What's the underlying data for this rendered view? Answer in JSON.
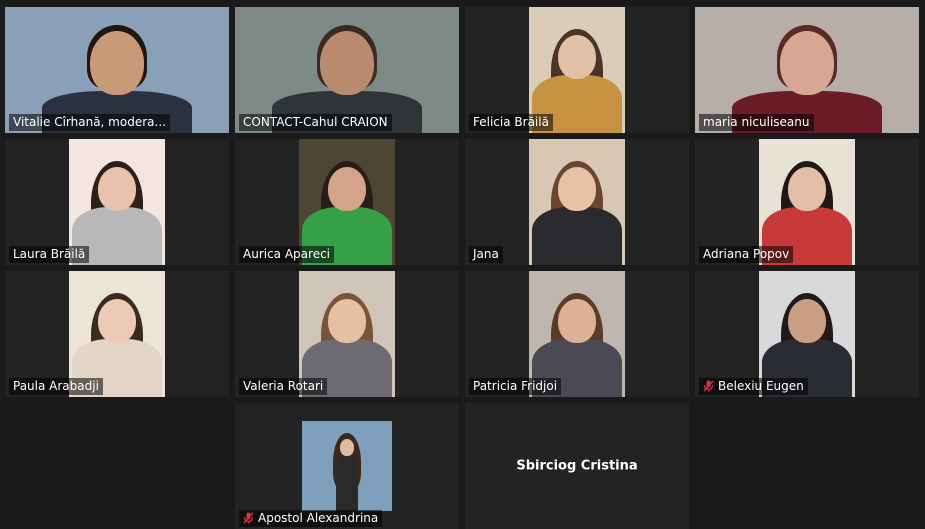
{
  "participants": [
    {
      "name": "Vitalie Cîrhană, modera...",
      "muted": false,
      "active": false,
      "video": true,
      "style": "office",
      "colors": {
        "bg": "#8aa0b8",
        "skin": "#c99a78",
        "hair": "#1e1712",
        "shirt": "#2b3140"
      }
    },
    {
      "name": "CONTACT-Cahul CRAION",
      "muted": false,
      "active": true,
      "video": true,
      "style": "office",
      "colors": {
        "bg": "#7d8a86",
        "skin": "#b98a6e",
        "hair": "#3a2b22",
        "shirt": "#2e3438"
      }
    },
    {
      "name": "Felicia Brăilă",
      "muted": false,
      "active": false,
      "video": true,
      "style": "portrait",
      "colors": {
        "bg": "#d9cdb8",
        "skin": "#e2c0a6",
        "hair": "#4a3426",
        "shirt": "#c79340"
      }
    },
    {
      "name": "maria niculiseanu",
      "muted": false,
      "active": false,
      "video": true,
      "style": "office",
      "colors": {
        "bg": "#b7aeaa",
        "skin": "#d6a893",
        "hair": "#5a2b22",
        "shirt": "#6c1c26"
      }
    },
    {
      "name": "Laura Brăilă",
      "muted": false,
      "active": false,
      "video": true,
      "style": "portrait",
      "colors": {
        "bg": "#f2e6df",
        "skin": "#e7c3ae",
        "hair": "#2c2018",
        "shirt": "#b8b8b8"
      }
    },
    {
      "name": "Aurica Apareci",
      "muted": false,
      "active": false,
      "video": true,
      "style": "portrait",
      "colors": {
        "bg": "#4e4634",
        "skin": "#d4a488",
        "hair": "#2a1d16",
        "shirt": "#35a046"
      }
    },
    {
      "name": "Jana",
      "muted": false,
      "active": false,
      "video": true,
      "style": "portrait",
      "colors": {
        "bg": "#d8c7b5",
        "skin": "#e6c2a6",
        "hair": "#6a4530",
        "shirt": "#2a2a2e"
      }
    },
    {
      "name": "Adriana Popov",
      "muted": false,
      "active": false,
      "video": true,
      "style": "portrait",
      "colors": {
        "bg": "#e8e2d6",
        "skin": "#e2bfa6",
        "hair": "#1f1814",
        "shirt": "#c83a3a"
      }
    },
    {
      "name": "Paula Arabadji",
      "muted": false,
      "active": false,
      "video": true,
      "style": "portrait",
      "colors": {
        "bg": "#ece4d6",
        "skin": "#eccbb4",
        "hair": "#3b2a1f",
        "shirt": "#e3d4c8"
      }
    },
    {
      "name": "Valeria Rotari",
      "muted": false,
      "active": false,
      "video": true,
      "style": "portrait",
      "colors": {
        "bg": "#cfc6b9",
        "skin": "#e4c0a4",
        "hair": "#7a5436",
        "shirt": "#6e6a72"
      }
    },
    {
      "name": "Patricia Fridjoi",
      "muted": false,
      "active": false,
      "video": true,
      "style": "portrait",
      "colors": {
        "bg": "#bfb6ad",
        "skin": "#dcb296",
        "hair": "#5a3a28",
        "shirt": "#4a4a55"
      }
    },
    {
      "name": "Belexiu Eugen",
      "muted": true,
      "active": false,
      "video": true,
      "style": "portrait",
      "colors": {
        "bg": "#d7d9da",
        "skin": "#c99f84",
        "hair": "#21191a",
        "shirt": "#2a2c33"
      }
    },
    {
      "name": "Apostol Alexandrina",
      "muted": true,
      "active": false,
      "video": true,
      "style": "thumb",
      "colors": {
        "bg": "#7fa0bd",
        "skin": "#e0bda2",
        "hair": "#3a2a1e",
        "shirt": "#2a2a2a"
      }
    },
    {
      "name": "Sbirciog Cristina",
      "muted": false,
      "active": false,
      "video": false,
      "style": "none",
      "colors": {
        "bg": "#232323",
        "skin": "",
        "hair": "",
        "shirt": ""
      }
    }
  ],
  "icons": {
    "muted_mic": "muted-mic-icon"
  },
  "colors": {
    "active_border": "#c9e265",
    "tile_bg": "#232323",
    "page_bg": "#1a1a1a",
    "muted_red": "#e0303a"
  }
}
